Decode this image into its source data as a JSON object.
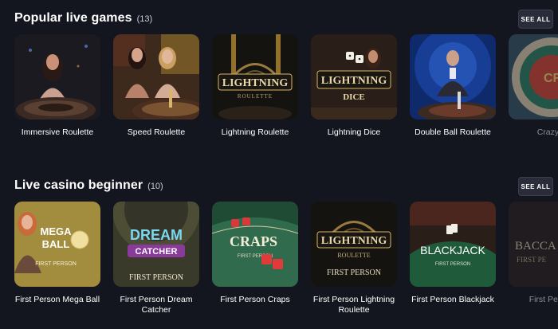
{
  "sections": [
    {
      "title": "Popular live games",
      "count": "(13)",
      "see_all": "SEE ALL",
      "games": [
        {
          "name": "Immersive Roulette"
        },
        {
          "name": "Speed Roulette"
        },
        {
          "name": "Lightning Roulette",
          "art_line1": "LIGHTNING",
          "art_line2": "ROULETTE"
        },
        {
          "name": "Lightning Dice",
          "art_line1": "LIGHTNING",
          "art_line2": "DICE"
        },
        {
          "name": "Double Ball Roulette"
        },
        {
          "name": "Crazy T",
          "art_line1": "CRA"
        }
      ]
    },
    {
      "title": "Live casino beginner",
      "count": "(10)",
      "see_all": "SEE ALL",
      "games": [
        {
          "name": "First Person Mega Ball",
          "art_line1": "MEGA",
          "art_line2": "BALL",
          "art_line3": "FIRST PERSON"
        },
        {
          "name": "First Person Dream Catcher",
          "art_line1": "DREAM",
          "art_line2": "CATCHER",
          "art_line3": "FIRST PERSON"
        },
        {
          "name": "First Person Craps",
          "art_line1": "CRAPS",
          "art_line2": "FIRST PERSON"
        },
        {
          "name": "First Person Lightning Roulette",
          "art_line1": "LIGHTNING",
          "art_line2": "ROULETTE",
          "art_line3": "FIRST PERSON"
        },
        {
          "name": "First Person Blackjack",
          "art_line1": "BLACKJACK",
          "art_line2": "FIRST PERSON"
        },
        {
          "name": "First Person",
          "art_line1": "BACCA",
          "art_line2": "FIRST PE"
        }
      ]
    }
  ],
  "colors": {
    "background": "#14161f",
    "button": "#2a2d39",
    "gold": "#d8b56a",
    "table_green": "#2f6b4c"
  }
}
